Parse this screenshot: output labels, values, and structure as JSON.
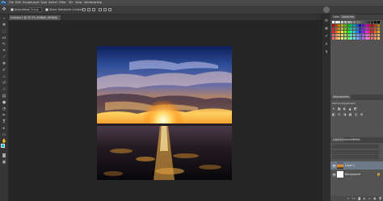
{
  "menubar": {
    "logo": "Ps",
    "items": [
      {
        "label": "File"
      },
      {
        "label": "Edit"
      },
      {
        "label": "Image"
      },
      {
        "label": "Layer"
      },
      {
        "label": "Type"
      },
      {
        "label": "Select"
      },
      {
        "label": "Filter"
      },
      {
        "label": "3D"
      },
      {
        "label": "View"
      },
      {
        "label": "Window"
      },
      {
        "label": "Help"
      }
    ]
  },
  "options_bar": {
    "auto_select_label": "Auto-Select:",
    "auto_select_value": "Group",
    "transform_controls_label": "Show Transform Controls"
  },
  "document": {
    "tab_label": "Untitled-1 @ 33.3% (RGB/8) (RGB/8)"
  },
  "panels": {
    "color_tabs": [
      "Color",
      "Swatches"
    ],
    "adjustments_tab": "Adjustments",
    "adjustments_label": "Add an adjustment",
    "layers_tabs": [
      "Layers",
      "Channels",
      "Paths"
    ],
    "layers": [
      {
        "name": "Layer 1"
      },
      {
        "name": "Background"
      }
    ]
  },
  "colors": {
    "ui_dark": "#1e1e1e",
    "panel": "#535353",
    "foreground_swatch": "#00c0e0",
    "background_swatch": "#ffffff"
  }
}
